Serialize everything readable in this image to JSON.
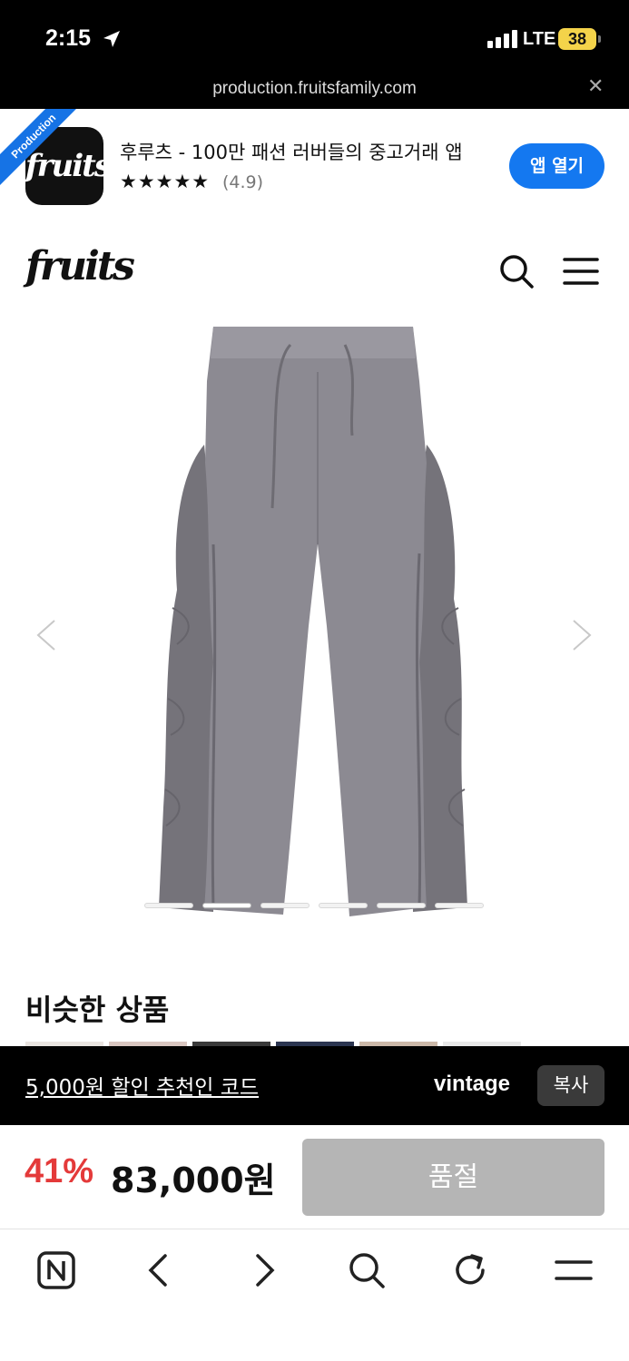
{
  "status_bar": {
    "time": "2:15",
    "carrier": "LTE",
    "battery": "38"
  },
  "browser": {
    "url": "production.fruitsfamily.com",
    "close_symbol": "✕"
  },
  "app_banner": {
    "ribbon": "Production",
    "icon_text": "fruits",
    "title": "후루츠 - 100만 패션 러버들의 중고거래 앱",
    "stars": "★★★★★",
    "rating": "(4.9)",
    "open_label": "앱 열기"
  },
  "header": {
    "logo": "fruits"
  },
  "product": {
    "image_icon": "pants-photo",
    "slide_count": 6,
    "active_slide": 2
  },
  "similar": {
    "title": "비슷한 상품"
  },
  "referral": {
    "text": "5,000원 할인 추천인 코드",
    "code": "vintage",
    "copy_label": "복사"
  },
  "purchase": {
    "discount": "41%",
    "price": "83,000원",
    "soldout_label": "품절"
  },
  "colors": {
    "accent_blue": "#1478f0",
    "discount_red": "#e43a3a",
    "battery_yellow": "#f4d34a"
  }
}
